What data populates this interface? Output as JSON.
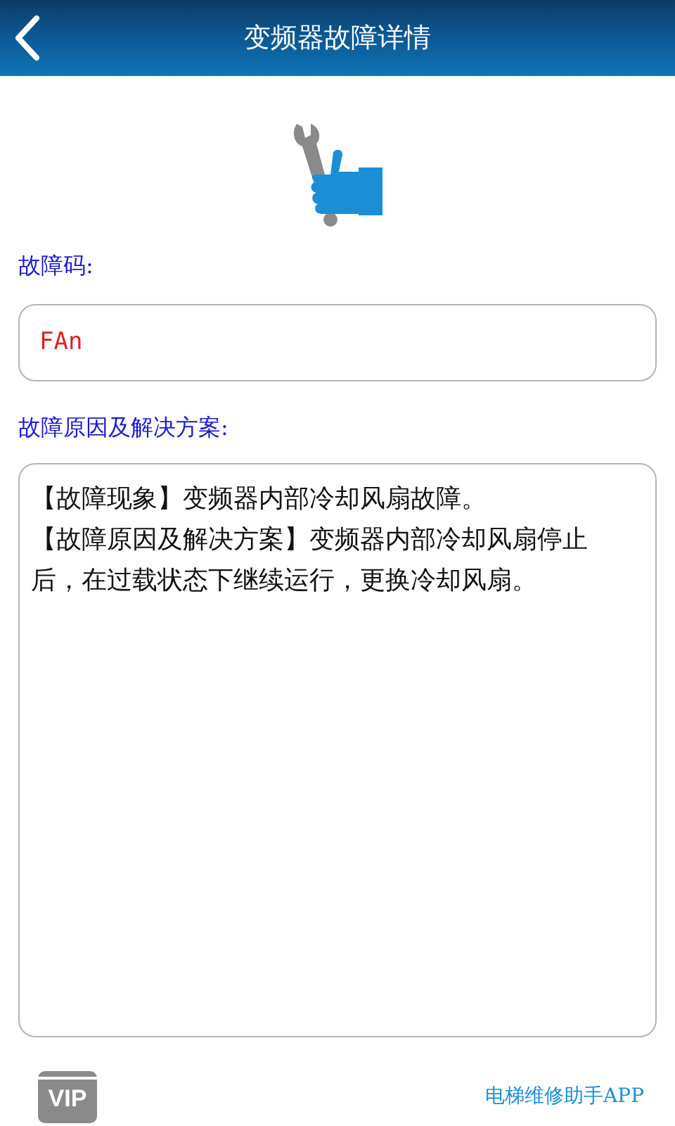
{
  "header": {
    "title": "变频器故障详情"
  },
  "fault_code": {
    "label": "故障码:",
    "value": "FAn"
  },
  "solution": {
    "label": "故障原因及解决方案:",
    "lines": [
      "【故障现象】变频器内部冷却风扇故障。",
      "【故障原因及解决方案】变频器内部冷却风扇停止后，在过载状态下继续运行，更换冷却风扇。"
    ]
  },
  "footer": {
    "badge": "VIP",
    "app_name": "电梯维修助手APP"
  }
}
